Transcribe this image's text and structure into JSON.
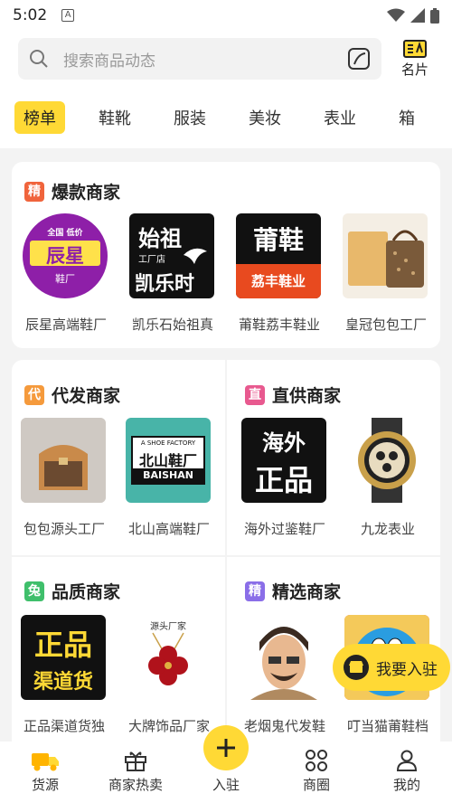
{
  "status": {
    "time": "5:02",
    "a_glyph": "A"
  },
  "search": {
    "placeholder": "搜索商品动态",
    "card_label": "名片"
  },
  "tabs": [
    "榜单",
    "鞋靴",
    "服装",
    "美妆",
    "表业",
    "箱"
  ],
  "sections": {
    "hot": {
      "icon_char": "精",
      "title": "爆款商家",
      "accent": "#f0643c",
      "items": [
        {
          "label": "辰星高端鞋厂",
          "logo_top": "全国 低价",
          "logo_main": "辰星",
          "logo_sub": "鞋厂"
        },
        {
          "label": "凯乐石始祖真",
          "logo_top": "始祖",
          "logo_mid": "工厂店",
          "logo_main": "凯乐时"
        },
        {
          "label": "莆鞋荔丰鞋业",
          "logo_main": "莆鞋",
          "logo_sub": "荔丰鞋业"
        },
        {
          "label": "皇冠包包工厂"
        }
      ]
    },
    "daifa": {
      "icon_char": "代",
      "title": "代发商家",
      "accent": "#f59a3c",
      "items": [
        {
          "label": "包包源头工厂"
        },
        {
          "label": "北山高端鞋厂",
          "logo_top": "A SHOE FACTORY",
          "logo_main": "北山鞋厂",
          "logo_sub": "BAISHAN"
        }
      ]
    },
    "zhigong": {
      "icon_char": "直",
      "title": "直供商家",
      "accent": "#e8598f",
      "items": [
        {
          "label": "海外过鉴鞋厂",
          "logo_top": "海外",
          "logo_main": "正品"
        },
        {
          "label": "九龙表业"
        }
      ]
    },
    "pinzhi": {
      "icon_char": "兔",
      "title": "品质商家",
      "accent": "#3fbf6b",
      "items": [
        {
          "label": "正品渠道货独",
          "logo_top": "正品",
          "logo_main": "渠道货"
        },
        {
          "label": "大牌饰品厂家",
          "logo_top": "源头厂家"
        }
      ]
    },
    "jingxuan": {
      "icon_char": "精",
      "title": "精选商家",
      "accent": "#8a6ee8",
      "items": [
        {
          "label": "老烟鬼代发鞋"
        },
        {
          "label": "叮当猫莆鞋档"
        }
      ]
    }
  },
  "float_button": {
    "label": "我要入驻"
  },
  "bottom_nav": [
    {
      "label": "货源",
      "icon": "truck-icon",
      "active": true
    },
    {
      "label": "商家热卖",
      "icon": "gift-icon"
    },
    {
      "label": "入驻",
      "icon": "plus-icon"
    },
    {
      "label": "商圈",
      "icon": "grid-icon"
    },
    {
      "label": "我的",
      "icon": "user-icon"
    }
  ],
  "colors": {
    "accent": "#ffd935",
    "background": "#f3f3f3"
  }
}
